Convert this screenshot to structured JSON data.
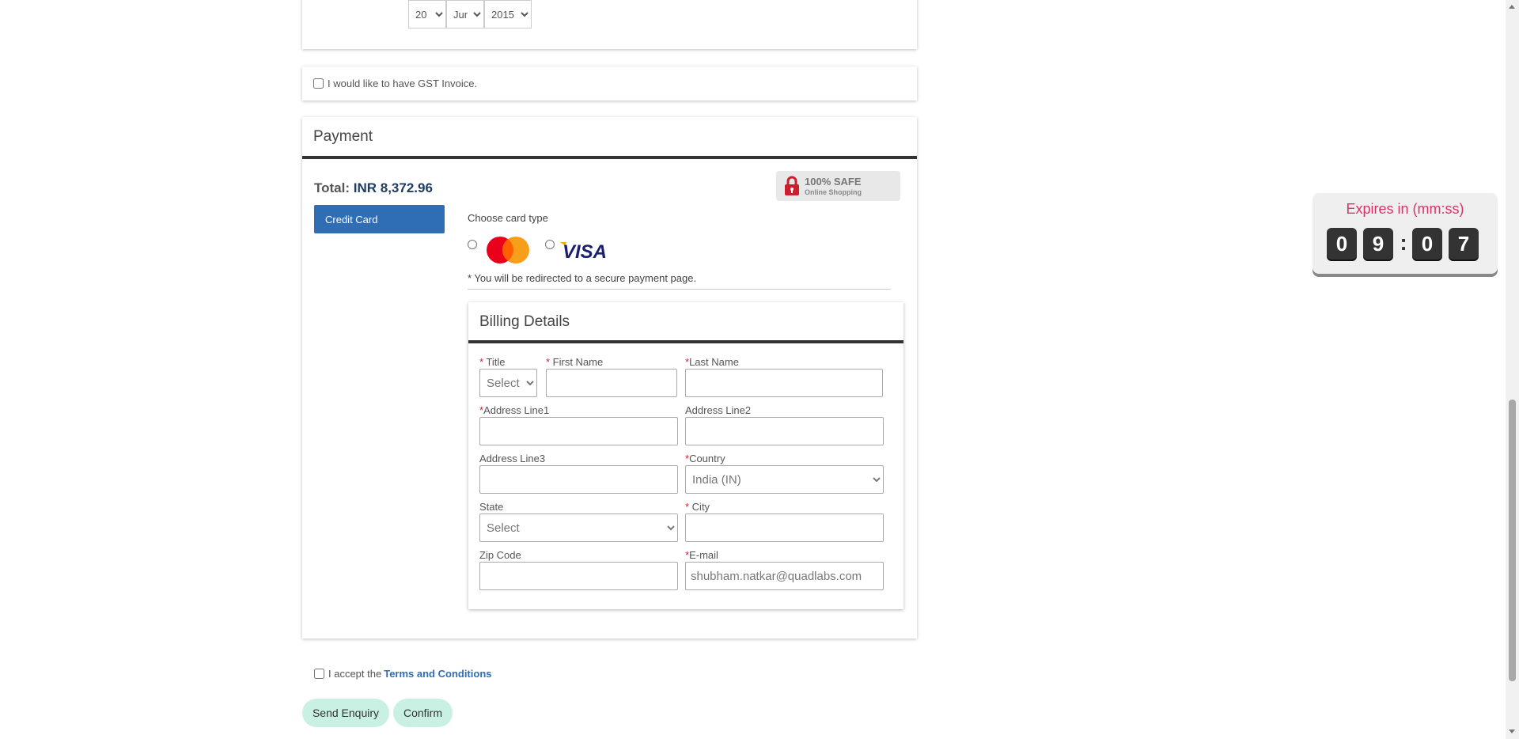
{
  "dob": {
    "day": "20",
    "month": "Jun",
    "year": "2015"
  },
  "gst": {
    "label": "I would like to have GST Invoice."
  },
  "payment": {
    "title": "Payment",
    "total_label": "Total:",
    "total_amount": "INR 8,372.96",
    "method_button": "Credit Card",
    "safe_badge": {
      "line1": "100% SAFE",
      "line2": "Online Shopping"
    },
    "card_type_label": "Choose card type",
    "card_options": [
      "mastercard-logo",
      "visa-logo"
    ],
    "visa_text": "VISA",
    "redirect_note": "* You will be redirected to a secure payment page.",
    "brand_colors": {
      "button": "#2f6db5",
      "required": "#d9232d",
      "mc_red": "#eb001b",
      "mc_orange": "#f79e1b",
      "visa_blue": "#1a1f71"
    }
  },
  "billing": {
    "title": "Billing Details",
    "fields": {
      "title_label": "Title",
      "title_value": "Select",
      "first_name_label": "First Name",
      "last_name_label": "Last Name",
      "address1_label": "Address Line1",
      "address2_label": "Address Line2",
      "address3_label": "Address Line3",
      "country_label": "Country",
      "country_value": "India (IN)",
      "state_label": "State",
      "state_value": "Select",
      "city_label": "City",
      "zip_label": "Zip Code",
      "email_label": "E-mail",
      "email_value": "shubham.natkar@quadlabs.com"
    }
  },
  "terms": {
    "prefix": "I accept the",
    "link": "Terms and Conditions"
  },
  "actions": {
    "send_enquiry": "Send Enquiry",
    "confirm": "Confirm"
  },
  "timer": {
    "label": "Expires in (mm:ss)",
    "digits": [
      "0",
      "9",
      "0",
      "7"
    ],
    "separator": ":"
  }
}
